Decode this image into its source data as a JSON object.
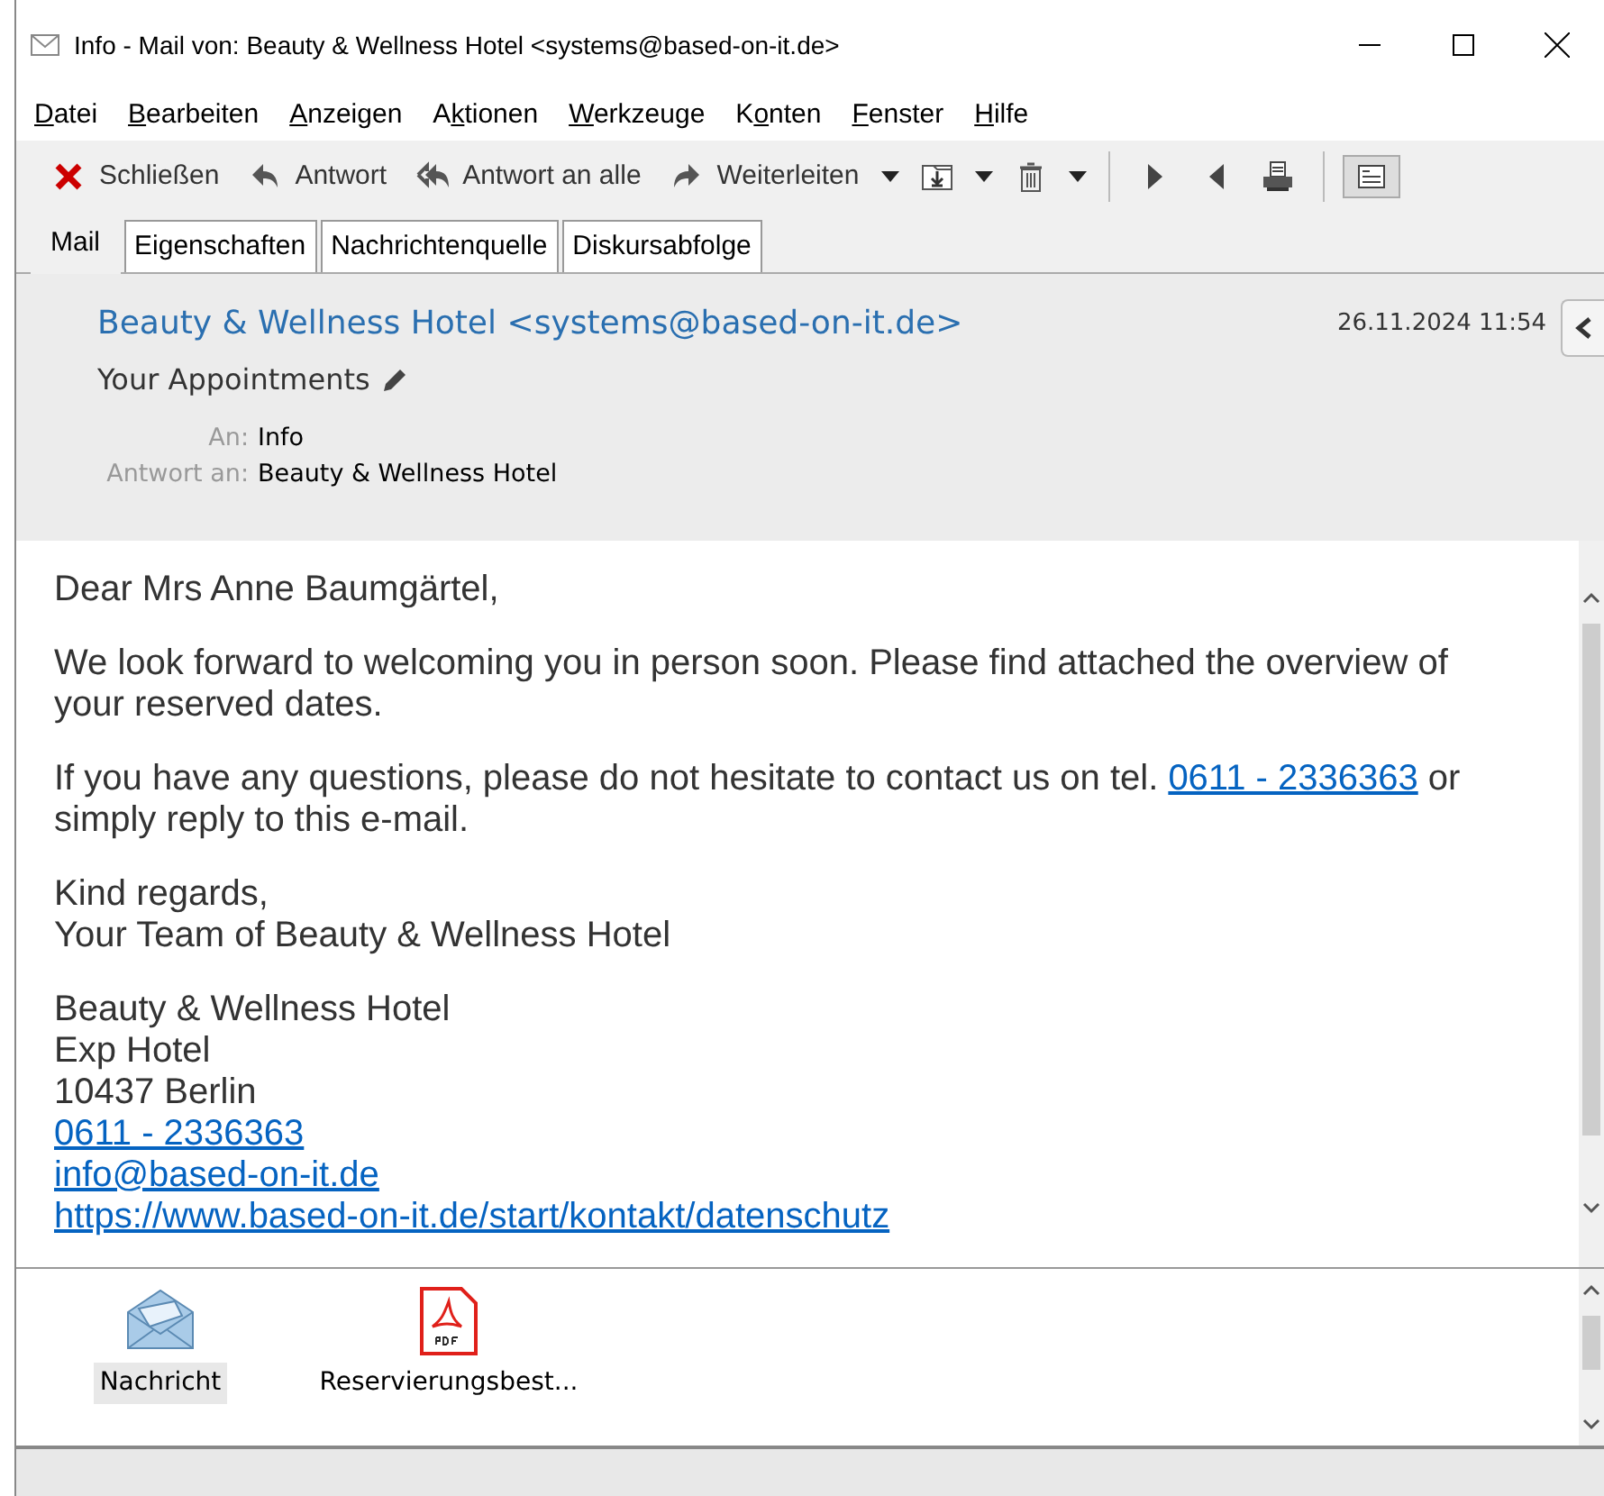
{
  "window": {
    "title": "Info - Mail von: Beauty & Wellness Hotel <systems@based-on-it.de>"
  },
  "menu": [
    {
      "access_key": "D",
      "after": "atei"
    },
    {
      "access_key": "B",
      "after": "earbeiten"
    },
    {
      "access_key": "A",
      "after": "nzeigen"
    },
    {
      "before": "A",
      "access_key": "k",
      "after": "tionen"
    },
    {
      "access_key": "W",
      "after": "erkzeuge"
    },
    {
      "before": "K",
      "access_key": "o",
      "after": "nten"
    },
    {
      "access_key": "F",
      "after": "enster"
    },
    {
      "access_key": "H",
      "after": "ilfe"
    }
  ],
  "toolbar": [
    {
      "kind": "close",
      "label": "Schließen"
    },
    {
      "kind": "reply",
      "label": "Antwort"
    },
    {
      "kind": "replyall",
      "label": "Antwort an alle"
    },
    {
      "kind": "forward",
      "label": "Weiterleiten",
      "dropdown": true
    },
    {
      "kind": "move",
      "dropdown": true
    },
    {
      "kind": "delete",
      "dropdown": true
    },
    {
      "kind": "sep"
    },
    {
      "kind": "next"
    },
    {
      "kind": "prev"
    },
    {
      "kind": "print"
    },
    {
      "kind": "sep"
    },
    {
      "kind": "view"
    }
  ],
  "tabs": [
    {
      "label": "Mail",
      "selected": true
    },
    {
      "label": "Eigenschaften",
      "selected": false
    },
    {
      "label": "Nachrichtenquelle",
      "selected": false
    },
    {
      "label": "Diskursabfolge",
      "selected": false
    }
  ],
  "header": {
    "from": "Beauty & Wellness Hotel <systems@based-on-it.de>",
    "date": "26.11.2024 11:54",
    "subject": "Your Appointments",
    "fields": [
      {
        "label": "An:",
        "value": "Info"
      },
      {
        "label": "Antwort an:",
        "value": "Beauty & Wellness Hotel"
      }
    ]
  },
  "body": [
    {
      "kind": "para",
      "lines": [
        {
          "text": "Dear Mrs Anne Baumgärtel,"
        }
      ]
    },
    {
      "kind": "para",
      "lines": [
        {
          "text": "We look forward to welcoming you in person soon. Please find attached the overview of your reserved dates."
        }
      ]
    },
    {
      "kind": "para",
      "lines": [
        {
          "text": "If you have any questions, please do not hesitate to contact us on tel. ",
          "link": "0611 - 2336363",
          "after": " or simply reply to this e-mail."
        }
      ]
    },
    {
      "kind": "para",
      "lines": [
        {
          "text": "Kind regards,"
        },
        {
          "text": "Your Team of Beauty & Wellness Hotel"
        }
      ]
    },
    {
      "kind": "para",
      "lines": [
        {
          "text": "Beauty & Wellness Hotel"
        },
        {
          "text": "Exp Hotel"
        },
        {
          "text": "10437 Berlin"
        },
        {
          "link": "0611 - 2336363"
        },
        {
          "link": "info@based-on-it.de"
        },
        {
          "link": "https://www.based-on-it.de/start/kontakt/datenschutz"
        }
      ]
    }
  ],
  "attachments": [
    {
      "kind": "message",
      "label": "Nachricht",
      "selected": true
    },
    {
      "kind": "pdf",
      "label": "Reservierungsbest...",
      "selected": false
    }
  ]
}
